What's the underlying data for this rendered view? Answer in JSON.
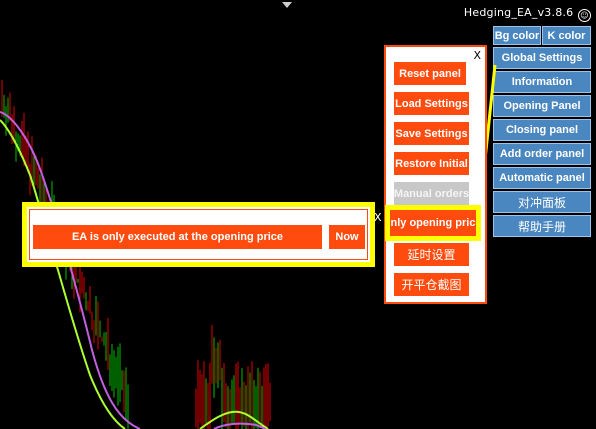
{
  "header": {
    "ea_title": "Hedging_EA_v3.8.6",
    "smile_glyph": "☺"
  },
  "menu": {
    "bg_color": "Bg color",
    "k_color": "K color",
    "items": [
      "Global Settings",
      "Information",
      "Opening Panel",
      "Closing panel",
      "Add order panel",
      "Automatic panel",
      "对冲面板",
      "帮助手册"
    ]
  },
  "settings_panel": {
    "close": "X",
    "buttons": [
      "Reset panel",
      "Load Settings",
      "Save Settings",
      "Restore Initial",
      "Manual orders",
      "nly opening pric",
      "延时设置",
      "开平仓截图"
    ]
  },
  "popup": {
    "message": "EA is only executed at the opening price",
    "now_button": "Now",
    "close": "X"
  },
  "colors": {
    "accent": "#ff4b0e",
    "menu_blue": "#4a86c0",
    "highlight": "#ffff00",
    "disabled": "#c8c8c8",
    "ma_fast": "#adff2f",
    "ma_slow": "#c060e0",
    "candle_up": "#00c000",
    "candle_down": "#e00000"
  }
}
